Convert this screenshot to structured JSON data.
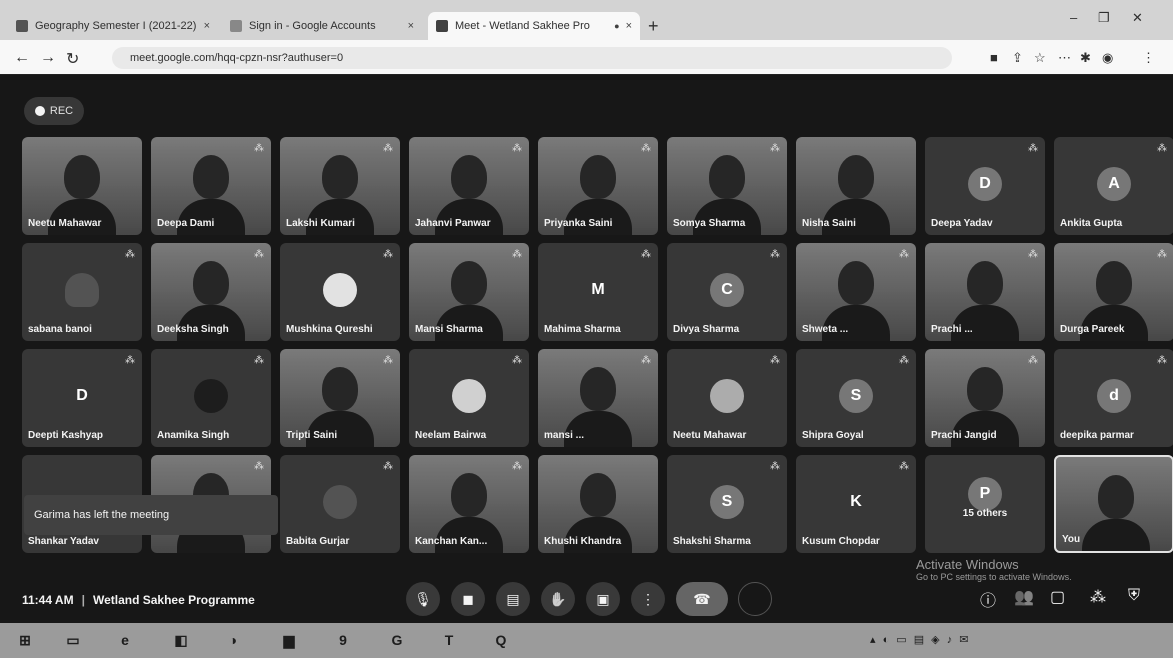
{
  "browser": {
    "tabs": [
      {
        "label": "Geography Semester I (2021-22)",
        "close": "×"
      },
      {
        "label": "Sign in - Google Accounts",
        "close": "×"
      },
      {
        "label": "Meet - Wetland Sakhee Pro",
        "close": "×"
      }
    ],
    "new_tab": "+",
    "url": "meet.google.com/hqq-cpzn-nsr?authuser=0"
  },
  "meeting": {
    "rec_label": "REC",
    "time": "11:44 AM",
    "title": "Wetland Sakhee Programme",
    "toast": "Garima has left the meeting",
    "overflow_label": "15 others",
    "self_label": "You",
    "participants": [
      {
        "name": "Neetu Mahawar",
        "avatar": ""
      },
      {
        "name": "Deepa Dami",
        "avatar": ""
      },
      {
        "name": "Lakshi Kumari",
        "avatar": ""
      },
      {
        "name": "Jahanvi Panwar",
        "avatar": ""
      },
      {
        "name": "Priyanka Saini",
        "avatar": ""
      },
      {
        "name": "Somya Sharma",
        "avatar": ""
      },
      {
        "name": "Nisha Saini",
        "avatar": ""
      },
      {
        "name": "Deepa Yadav",
        "avatar": "D"
      },
      {
        "name": "Ankita Gupta",
        "avatar": "A"
      },
      {
        "name": "sabana banoi",
        "avatar": ""
      },
      {
        "name": "Deeksha Singh",
        "avatar": ""
      },
      {
        "name": "Mushkina Qureshi",
        "avatar": ""
      },
      {
        "name": "Mansi Sharma",
        "avatar": ""
      },
      {
        "name": "Mahima Sharma",
        "avatar": "M"
      },
      {
        "name": "Divya Sharma",
        "avatar": "C"
      },
      {
        "name": "Shweta ...",
        "avatar": ""
      },
      {
        "name": "Prachi ...",
        "avatar": ""
      },
      {
        "name": "Durga Pareek",
        "avatar": ""
      },
      {
        "name": "Deepti Kashyap",
        "avatar": "D"
      },
      {
        "name": "Anamika Singh",
        "avatar": ""
      },
      {
        "name": "Tripti Saini",
        "avatar": ""
      },
      {
        "name": "Neelam Bairwa",
        "avatar": ""
      },
      {
        "name": "mansi ...",
        "avatar": ""
      },
      {
        "name": "Neetu Mahawar",
        "avatar": ""
      },
      {
        "name": "Shipra Goyal",
        "avatar": "S"
      },
      {
        "name": "Prachi Jangid",
        "avatar": ""
      },
      {
        "name": "deepika parmar",
        "avatar": "d"
      },
      {
        "name": "Shankar Yadav",
        "avatar": ""
      },
      {
        "name": "",
        "avatar": ""
      },
      {
        "name": "Babita Gurjar",
        "avatar": ""
      },
      {
        "name": "Kanchan Kan...",
        "avatar": ""
      },
      {
        "name": "Khushi Khandra",
        "avatar": ""
      },
      {
        "name": "Shakshi Sharma",
        "avatar": "S"
      },
      {
        "name": "Kusum Chopdar",
        "avatar": "K"
      }
    ]
  },
  "windows": {
    "activate_title": "Activate Windows",
    "activate_sub": "Go to PC settings to activate Windows."
  }
}
